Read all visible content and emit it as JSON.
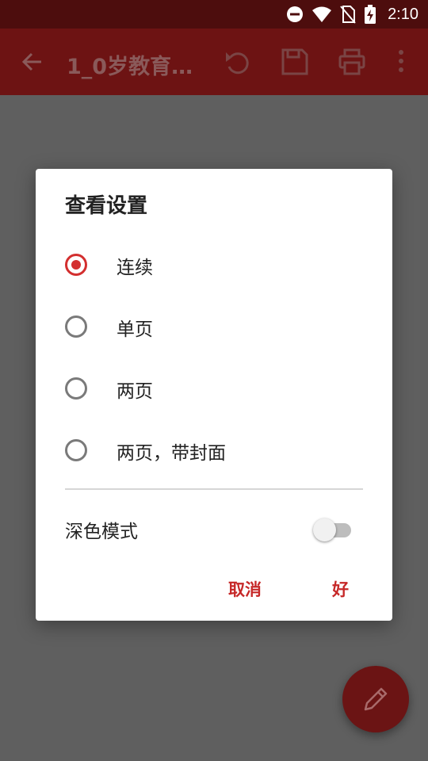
{
  "status": {
    "time": "2:10",
    "icons": [
      "do-not-disturb-icon",
      "wifi-icon",
      "no-sim-icon",
      "battery-charging-icon"
    ]
  },
  "appbar": {
    "title": "1_0岁教育…",
    "icons": [
      "back-arrow-icon",
      "undo-icon",
      "save-icon",
      "print-icon",
      "more-vert-icon"
    ]
  },
  "dialog": {
    "title": "查看设置",
    "options": [
      {
        "label": "连续",
        "checked": true
      },
      {
        "label": "单页",
        "checked": false
      },
      {
        "label": "两页",
        "checked": false
      },
      {
        "label": "两页，带封面",
        "checked": false
      }
    ],
    "dark_mode": {
      "label": "深色模式",
      "enabled": false
    },
    "cancel_label": "取消",
    "ok_label": "好"
  },
  "fab": {
    "icon": "edit-pencil-icon"
  },
  "colors": {
    "accent": "#d32f2f",
    "appbar": "#6d1313",
    "statusbar": "#4d0d0d",
    "scrim": "#5f5f5f"
  }
}
